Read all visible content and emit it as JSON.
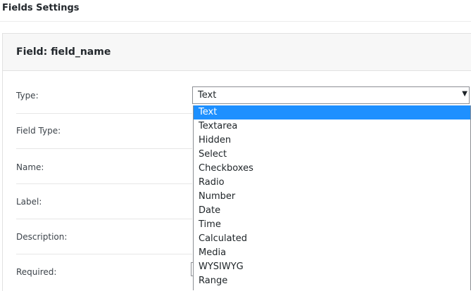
{
  "page": {
    "title": "Fields Settings"
  },
  "panel": {
    "title": "Field: field_name"
  },
  "labels": {
    "type": "Type:",
    "field_type": "Field Type:",
    "name": "Name:",
    "label": "Label:",
    "description": "Description:",
    "required": "Required:"
  },
  "type_select": {
    "value": "Text",
    "arrow_icon": "triangle-down-icon",
    "options": [
      "Text",
      "Textarea",
      "Hidden",
      "Select",
      "Checkboxes",
      "Radio",
      "Number",
      "Date",
      "Time",
      "Calculated",
      "Media",
      "WYSIWYG",
      "Range"
    ],
    "selected_index": 0
  },
  "colors": {
    "selection": "#1e90ff"
  }
}
